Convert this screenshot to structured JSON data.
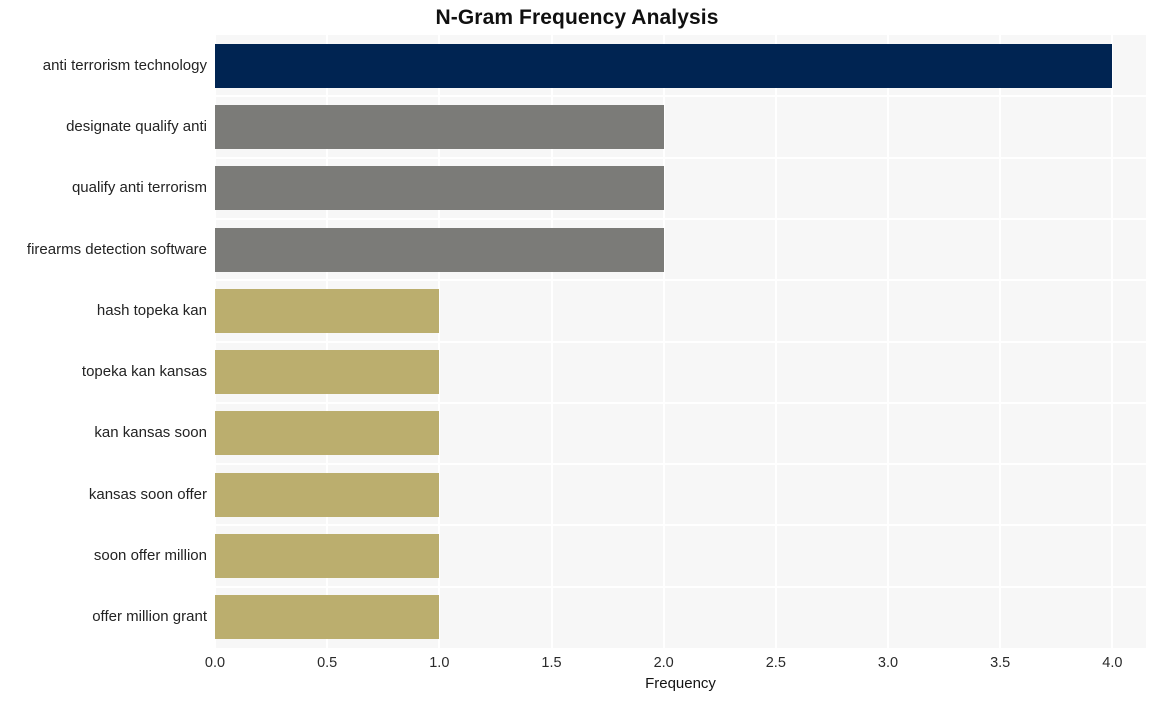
{
  "chart_data": {
    "type": "bar",
    "orientation": "horizontal",
    "title": "N-Gram Frequency Analysis",
    "xlabel": "Frequency",
    "ylabel": "",
    "xlim": [
      0,
      4.15
    ],
    "ylim": null,
    "grid": true,
    "legend": null,
    "categories": [
      "anti terrorism technology",
      "designate qualify anti",
      "qualify anti terrorism",
      "firearms detection software",
      "hash topeka kan",
      "topeka kan kansas",
      "kan kansas soon",
      "kansas soon offer",
      "soon offer million",
      "offer million grant"
    ],
    "values": [
      4,
      2,
      2,
      2,
      1,
      1,
      1,
      1,
      1,
      1
    ],
    "bar_colors": [
      "#002452",
      "#7b7b78",
      "#7b7b78",
      "#7b7b78",
      "#bbae6e",
      "#bbae6e",
      "#bbae6e",
      "#bbae6e",
      "#bbae6e",
      "#bbae6e"
    ],
    "xticks": [
      0.0,
      0.5,
      1.0,
      1.5,
      2.0,
      2.5,
      3.0,
      3.5,
      4.0
    ],
    "xtick_labels": [
      "0.0",
      "0.5",
      "1.0",
      "1.5",
      "2.0",
      "2.5",
      "3.0",
      "3.5",
      "4.0"
    ],
    "colors": {
      "plot_background": "#f7f7f7",
      "figure_background": "#ffffff",
      "gridline": "#ffffff",
      "title_text": "#101010",
      "tick_text": "#2a2a2a",
      "navy": "#002452",
      "gray": "#7b7b78",
      "khaki": "#bbae6e"
    }
  }
}
